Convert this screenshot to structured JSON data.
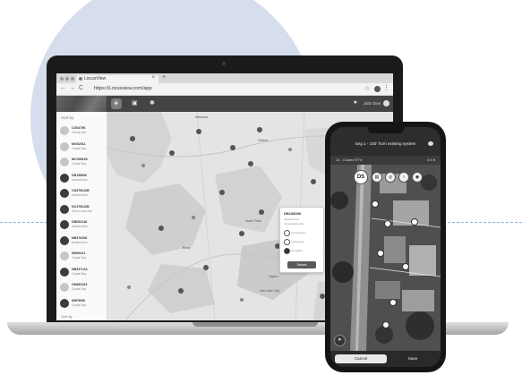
{
  "browser": {
    "tab_label": "LocusView",
    "url": "https://Locusview.com/app",
    "close_glyph": "×",
    "new_tab_glyph": "+",
    "back_glyph": "←",
    "forward_glyph": "→",
    "reload_glyph": "C",
    "star_glyph": "☆",
    "menu_glyph": "⋮"
  },
  "app_header": {
    "user_label": "John Doe",
    "nav_icons": [
      "layers-icon",
      "box-icon",
      "gear-icon"
    ]
  },
  "sidebar": {
    "title": "Sort by",
    "footer": "Sort by",
    "items": [
      {
        "name": "CO64796",
        "sub": "Lincoln Ave",
        "dark": false
      },
      {
        "name": "MO02511",
        "sub": "Crystal Bay",
        "dark": false
      },
      {
        "name": "MC095169",
        "sub": "Crystal Bay",
        "dark": false
      },
      {
        "name": "DB158096",
        "sub": "Ashland Ave",
        "dark": true
      },
      {
        "name": "CN376610B",
        "sub": "Ashland Ave",
        "dark": true
      },
      {
        "name": "NC376610B",
        "sub": "Green Lane Ave",
        "dark": true
      },
      {
        "name": "DB052148",
        "sub": "Ashland Ave",
        "dark": true
      },
      {
        "name": "NB376208",
        "sub": "Ashland Ave",
        "dark": true
      },
      {
        "name": "SM99121",
        "sub": "Crystal Bay",
        "dark": false
      },
      {
        "name": "NB33712A",
        "sub": "Crystal Bay",
        "dark": true
      },
      {
        "name": "ON582183",
        "sub": "Crystal Bay",
        "dark": false
      },
      {
        "name": "SBF5096",
        "sub": "Crystal Bay",
        "dark": true
      }
    ]
  },
  "map": {
    "cities": [
      {
        "label": "Missoula",
        "cls": "c1"
      },
      {
        "label": "Helena",
        "cls": "c2"
      },
      {
        "label": "Billings",
        "cls": "c3"
      },
      {
        "label": "Idaho Falls",
        "cls": "c4"
      },
      {
        "label": "Boise",
        "cls": "c5"
      },
      {
        "label": "Casper",
        "cls": "c6"
      },
      {
        "label": "Ogden",
        "cls": "c7"
      },
      {
        "label": "Salt Lake City",
        "cls": "c8"
      },
      {
        "label": "Rock Springs",
        "cls": "c9"
      }
    ]
  },
  "popup": {
    "title": "DB158096",
    "lines": [
      "Ashland Ave",
      "Construction Mgr"
    ],
    "rows": [
      "Construction",
      "In progress",
      "Complete"
    ],
    "button": "Details"
  },
  "phone": {
    "title": "Seg 1 - 100' from existing system",
    "sub_left": "12 - Closed ETV",
    "sub_right": "0.5 ft",
    "tool_big": "DS",
    "cancel": "Cancel",
    "save": "Save",
    "compass_glyph": "➤"
  },
  "colors": {
    "accent_circle": "#d6deed",
    "dashed_line": "#8fb2d6"
  }
}
